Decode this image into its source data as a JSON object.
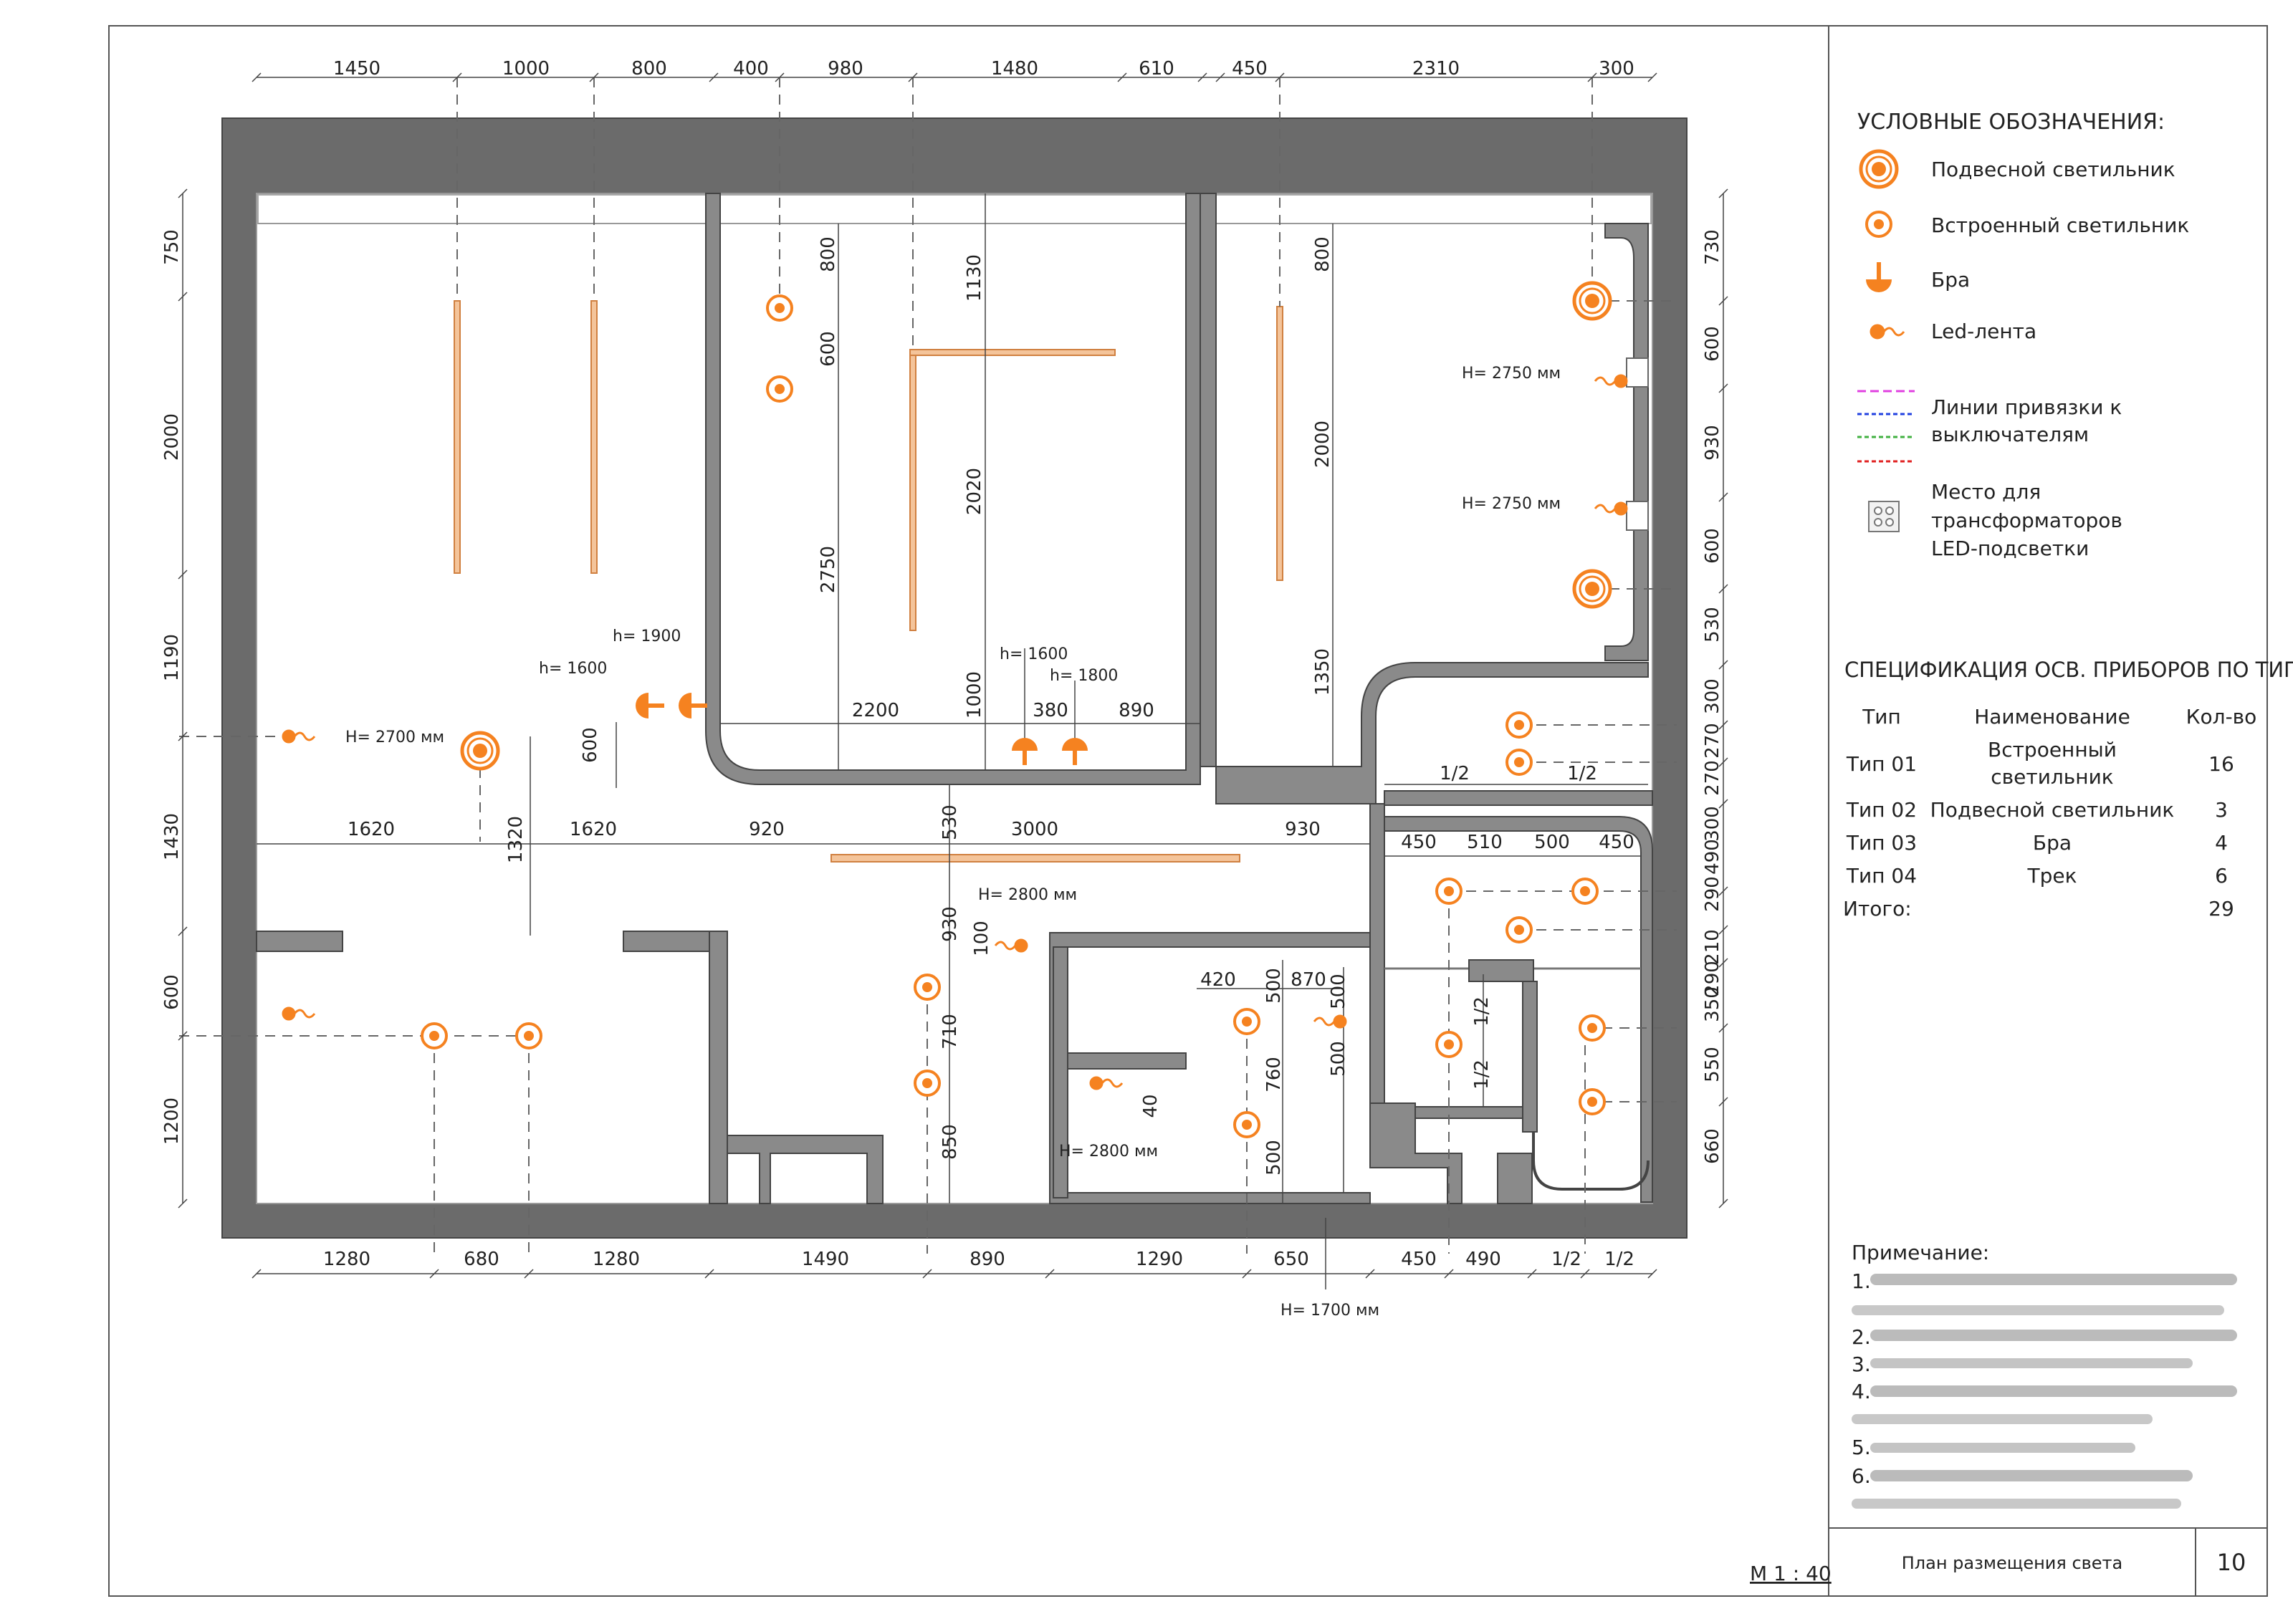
{
  "dims": {
    "top": [
      "1450",
      "1000",
      "800",
      "400",
      "980",
      "1480",
      "610",
      "450",
      "2310",
      "300"
    ],
    "bottom": [
      "1280",
      "680",
      "1280",
      "1490",
      "890",
      "1290",
      "650",
      "450",
      "490",
      "1/2",
      "1/2"
    ],
    "left": [
      "750",
      "2000",
      "1190",
      "1430",
      "600",
      "1200"
    ],
    "right": [
      "730",
      "600",
      "930",
      "600",
      "530",
      "300",
      "270",
      "270",
      "300",
      "490",
      "290",
      "210",
      "290",
      "350",
      "550",
      "660"
    ],
    "inner": [
      "800",
      "600",
      "1130",
      "2020",
      "2750",
      "1000",
      "2200",
      "380",
      "890",
      "800",
      "2000",
      "1350",
      "600",
      "1620",
      "1620",
      "1320",
      "920",
      "530",
      "3000",
      "930",
      "930",
      "100",
      "710",
      "850",
      "420",
      "870",
      "500",
      "500",
      "760",
      "500",
      "40",
      "500",
      "450",
      "510",
      "500",
      "450",
      "1/2",
      "1/2",
      "1/2",
      "1/2"
    ]
  },
  "labels": {
    "h2700": "H= 2700 мм",
    "h1900": "h= 1900",
    "h1600a": "h= 1600",
    "h1600b": "h= 1600",
    "h1800": "h= 1800",
    "h2750a": "H= 2750 мм",
    "h2750b": "H= 2750 мм",
    "h2800a": "H= 2800 мм",
    "h2800b": "H= 2800 мм",
    "h1700": "H= 1700 мм"
  },
  "legend": {
    "title": "УСЛОВНЫЕ ОБОЗНАЧЕНИЯ:",
    "pendant": "Подвесной светильник",
    "recessed": "Встроенный светильник",
    "sconce": "Бра",
    "led": "Led-лента",
    "lines1": "Линии привязки к",
    "lines2": "выключателям",
    "trans1": "Место для",
    "trans2": "трансформаторов",
    "trans3": "LED-подсветки"
  },
  "spec": {
    "title": "СПЕЦИФИКАЦИЯ ОСВ. ПРИБОРОВ ПО ТИПУ",
    "headers": [
      "Тип",
      "Наименование",
      "Кол-во"
    ],
    "rows": [
      {
        "type": "Тип 01",
        "name1": "Встроенный",
        "name2": "светильник",
        "qty": "16"
      },
      {
        "type": "Тип 02",
        "name1": "Подвесной светильник",
        "name2": "",
        "qty": "3"
      },
      {
        "type": "Тип 03",
        "name1": "Бра",
        "name2": "",
        "qty": "4"
      },
      {
        "type": "Тип 04",
        "name1": "Трек",
        "name2": "",
        "qty": "6"
      }
    ],
    "total_label": "Итого:",
    "total": "29"
  },
  "notes": {
    "title": "Примечание:",
    "items": [
      "1.",
      "2.",
      "3.",
      "4.",
      "5.",
      "6."
    ]
  },
  "stamp": {
    "title": "План размещения света",
    "sheet": "10"
  },
  "scale": "М 1 : 40",
  "colors": {
    "wall": "#6b6b6b",
    "wall_inner": "#8a8a8a",
    "orange": "#f58220",
    "track": "#f4c49a",
    "dim": "#333333",
    "magenta": "#e040e0",
    "blue": "#2040e0",
    "green": "#40b040",
    "red": "#e02020"
  }
}
